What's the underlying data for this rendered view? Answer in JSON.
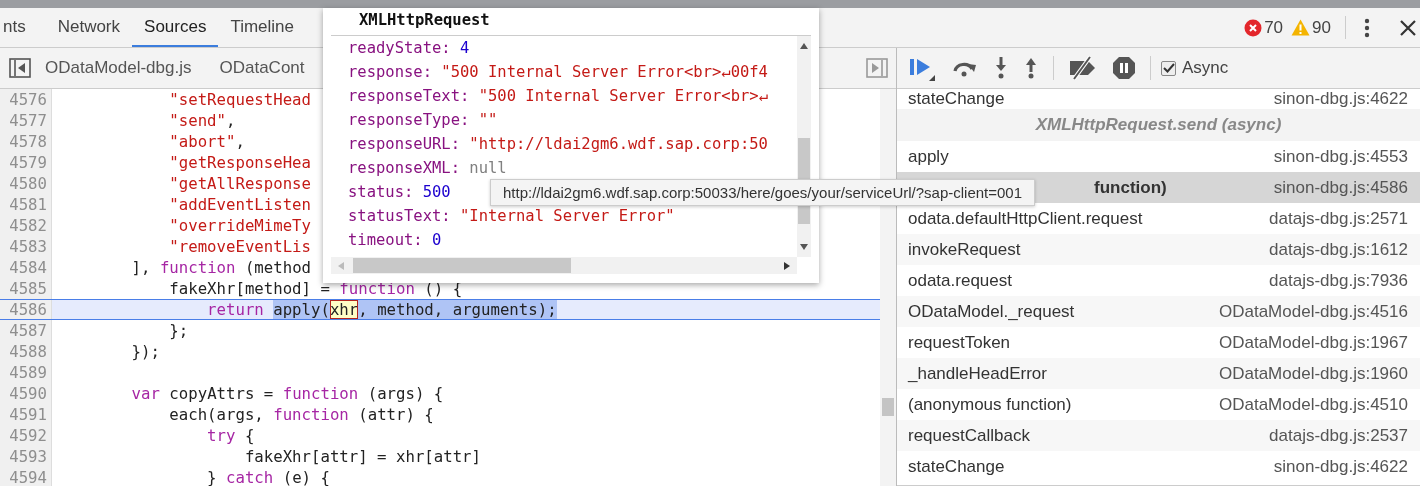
{
  "tabs": [
    {
      "label": "nts",
      "selected": false
    },
    {
      "label": "Network",
      "selected": false
    },
    {
      "label": "Sources",
      "selected": true
    },
    {
      "label": "Timeline",
      "selected": false
    }
  ],
  "counts": {
    "errors": "70",
    "warnings": "90"
  },
  "file_tabs": [
    {
      "label": "ODataModel-dbg.js"
    },
    {
      "label": "ODataCont"
    }
  ],
  "debugger": {
    "async": {
      "label": "Async",
      "checked": true
    }
  },
  "editor": {
    "lines": [
      {
        "number": "4576",
        "current": false,
        "tokens": [
          {
            "kind": "str",
            "text": "            \"setRequestHead"
          }
        ]
      },
      {
        "number": "4577",
        "current": false,
        "tokens": [
          {
            "kind": "str",
            "text": "            \"send\""
          },
          {
            "kind": "plain",
            "text": ","
          }
        ]
      },
      {
        "number": "4578",
        "current": false,
        "tokens": [
          {
            "kind": "str",
            "text": "            \"abort\""
          },
          {
            "kind": "plain",
            "text": ","
          }
        ]
      },
      {
        "number": "4579",
        "current": false,
        "tokens": [
          {
            "kind": "str",
            "text": "            \"getResponseHea"
          }
        ]
      },
      {
        "number": "4580",
        "current": false,
        "tokens": [
          {
            "kind": "str",
            "text": "            \"getAllResponse"
          }
        ]
      },
      {
        "number": "4581",
        "current": false,
        "tokens": [
          {
            "kind": "str",
            "text": "            \"addEventListen"
          }
        ]
      },
      {
        "number": "4582",
        "current": false,
        "tokens": [
          {
            "kind": "str",
            "text": "            \"overrideMimeTy"
          }
        ]
      },
      {
        "number": "4583",
        "current": false,
        "tokens": [
          {
            "kind": "str",
            "text": "            \"removeEventLis"
          }
        ]
      },
      {
        "number": "4584",
        "current": false,
        "tokens": [
          {
            "kind": "plain",
            "text": "        ], "
          },
          {
            "kind": "kw",
            "text": "function"
          },
          {
            "kind": "plain",
            "text": " (method"
          }
        ]
      },
      {
        "number": "4585",
        "current": false,
        "tokens": [
          {
            "kind": "plain",
            "text": "            fakeXhr[method] = "
          },
          {
            "kind": "kw",
            "text": "function"
          },
          {
            "kind": "plain",
            "text": " () {"
          }
        ]
      },
      {
        "number": "4586",
        "current": true,
        "tokens": [
          {
            "kind": "kw",
            "text": "                return "
          },
          {
            "kind": "sel",
            "text": "apply("
          },
          {
            "kind": "hover",
            "text": "xhr"
          },
          {
            "kind": "sel",
            "text": ", method, arguments);"
          }
        ]
      },
      {
        "number": "4587",
        "current": false,
        "tokens": [
          {
            "kind": "plain",
            "text": "            };"
          }
        ]
      },
      {
        "number": "4588",
        "current": false,
        "tokens": [
          {
            "kind": "plain",
            "text": "        });"
          }
        ]
      },
      {
        "number": "4589",
        "current": false
      },
      {
        "number": "4590",
        "current": false,
        "tokens": [
          {
            "kind": "kw",
            "text": "        var"
          },
          {
            "kind": "plain",
            "text": " copyAttrs = "
          },
          {
            "kind": "kw",
            "text": "function"
          },
          {
            "kind": "plain",
            "text": " (args) {"
          }
        ]
      },
      {
        "number": "4591",
        "current": false,
        "tokens": [
          {
            "kind": "plain",
            "text": "            each(args, "
          },
          {
            "kind": "kw",
            "text": "function"
          },
          {
            "kind": "plain",
            "text": " (attr) {"
          }
        ]
      },
      {
        "number": "4592",
        "current": false,
        "tokens": [
          {
            "kind": "kw",
            "text": "                try"
          },
          {
            "kind": "plain",
            "text": " {"
          }
        ]
      },
      {
        "number": "4593",
        "current": false,
        "tokens": [
          {
            "kind": "plain",
            "text": "                    fakeXhr[attr] = xhr[attr]"
          }
        ]
      },
      {
        "number": "4594",
        "current": false,
        "tokens": [
          {
            "kind": "plain",
            "text": "                } "
          },
          {
            "kind": "kw",
            "text": "catch"
          },
          {
            "kind": "plain",
            "text": " (e) {"
          }
        ]
      }
    ]
  },
  "popover": {
    "title": "XMLHttpRequest",
    "rows": [
      {
        "key": "readyState:",
        "value": "4",
        "kind": "num"
      },
      {
        "key": "response:",
        "value": "\"500 Internal Server Error<br>↵00f4",
        "kind": "str"
      },
      {
        "key": "responseText:",
        "value": "\"500 Internal Server Error<br>↵",
        "kind": "str"
      },
      {
        "key": "responseType:",
        "value": "\"\"",
        "kind": "str"
      },
      {
        "key": "responseURL:",
        "value": "\"http://ldai2gm6.wdf.sap.corp:50",
        "kind": "str"
      },
      {
        "key": "responseXML:",
        "value": "null",
        "kind": "null"
      },
      {
        "key": "status:",
        "value": "500",
        "kind": "num"
      },
      {
        "key": "statusText:",
        "value": "\"Internal Server Error\"",
        "kind": "str"
      },
      {
        "key": "timeout:",
        "value": "0",
        "kind": "num"
      }
    ]
  },
  "tooltip": {
    "text": "http://ldai2gm6.wdf.sap.corp:50033/here/goes/your/serviceUrl/?sap-client=001"
  },
  "call_stack": [
    {
      "kind": "frame",
      "name": "stateChange",
      "location": "sinon-dbg.js:4622",
      "selected": false
    },
    {
      "kind": "async",
      "name": "XMLHttpRequest.send (async)"
    },
    {
      "kind": "frame",
      "name": "apply",
      "location": "sinon-dbg.js:4553",
      "selected": false
    },
    {
      "kind": "frame",
      "name": "function)",
      "location": "sinon-dbg.js:4586",
      "selected": true
    },
    {
      "kind": "frame",
      "name": "odata.defaultHttpClient.request",
      "location": "datajs-dbg.js:2571",
      "selected": false
    },
    {
      "kind": "frame",
      "name": "invokeRequest",
      "location": "datajs-dbg.js:1612",
      "selected": false
    },
    {
      "kind": "frame",
      "name": "odata.request",
      "location": "datajs-dbg.js:7936",
      "selected": false
    },
    {
      "kind": "frame",
      "name": "ODataModel._request",
      "location": "ODataModel-dbg.js:4516",
      "selected": false
    },
    {
      "kind": "frame",
      "name": "requestToken",
      "location": "ODataModel-dbg.js:1967",
      "selected": false
    },
    {
      "kind": "frame",
      "name": "_handleHeadError",
      "location": "ODataModel-dbg.js:1960",
      "selected": false
    },
    {
      "kind": "frame",
      "name": "(anonymous function)",
      "location": "ODataModel-dbg.js:4510",
      "selected": false
    },
    {
      "kind": "frame",
      "name": "requestCallback",
      "location": "datajs-dbg.js:2537",
      "selected": false
    },
    {
      "kind": "frame",
      "name": "stateChange",
      "location": "sinon-dbg.js:4622",
      "selected": false
    }
  ]
}
